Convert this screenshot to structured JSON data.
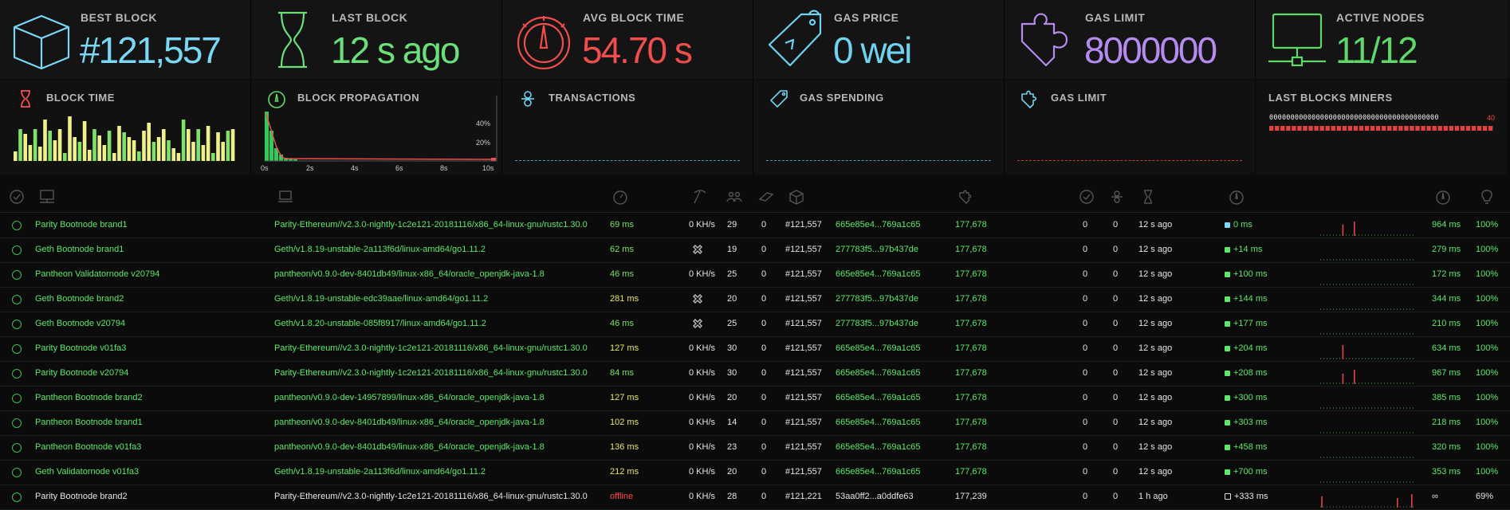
{
  "stats": [
    {
      "label": "BEST BLOCK",
      "value": "#121,557",
      "color": "#7ad8f5",
      "icon": "cube-icon"
    },
    {
      "label": "LAST BLOCK",
      "value": "12 s ago",
      "color": "#6be07a",
      "icon": "hourglass-icon"
    },
    {
      "label": "AVG BLOCK TIME",
      "value": "54.70 s",
      "color": "#f04e4e",
      "icon": "gauge-icon"
    },
    {
      "label": "GAS PRICE",
      "value": "0 wei",
      "color": "#6fd3f0",
      "icon": "price-tag-icon"
    },
    {
      "label": "GAS LIMIT",
      "value": "8000000 gas",
      "color": "#b58bf0",
      "icon": "puzzle-icon"
    },
    {
      "label": "ACTIVE NODES",
      "value": "11/12",
      "color": "#5fd86a",
      "icon": "network-icon"
    }
  ],
  "charts": {
    "block_time": {
      "label": "BLOCK TIME"
    },
    "block_propagation": {
      "label": "BLOCK PROPAGATION",
      "x_ticks": [
        "0s",
        "2s",
        "4s",
        "6s",
        "8s",
        "10s"
      ],
      "y_ticks": [
        "40%",
        "20%"
      ]
    },
    "transactions": {
      "label": "TRANSACTIONS"
    },
    "gas_spending": {
      "label": "GAS SPENDING"
    },
    "gas_limit": {
      "label": "GAS LIMIT"
    },
    "last_blocks_miners": {
      "label": "LAST BLOCKS MINERS",
      "miner": "0000000000000000000000000000000000000000",
      "count": "40"
    }
  },
  "table_header_icons": [
    "check-icon",
    "node-icon",
    "client-icon",
    "latency-icon",
    "mining-icon",
    "peers-icon",
    "pending-icon",
    "block-icon",
    "gas-limit-icon",
    "uncles-icon",
    "transactions-icon",
    "block-time-icon",
    "propagation-icon",
    "avg-propagation-icon",
    "uptime-icon"
  ],
  "nodes": [
    {
      "name": "Parity Bootnode brand1",
      "client": "Parity-Ethereum//v2.3.0-nightly-1c2e121-20181116/x86_64-linux-gnu/rustc1.30.0",
      "latency": "69 ms",
      "latency_class": "good",
      "hashrate": "0 KH/s",
      "peers": "29",
      "pending": "0",
      "block": "#121,557",
      "hash": "665e85e4...769a1c65",
      "gas": "177,678",
      "uncles": "0",
      "txs": "0",
      "last": "12 s ago",
      "prop": "0 ms",
      "prop_dot": "blue",
      "avg": "964 ms",
      "uptime": "100%",
      "offline": false,
      "hist": [
        {
          "x": 0.23,
          "h": 0.6
        },
        {
          "x": 0.35,
          "h": 0.75
        }
      ]
    },
    {
      "name": "Geth Bootnode brand1",
      "client": "Geth/v1.8.19-unstable-2a113f6d/linux-amd64/go1.11.2",
      "latency": "62 ms",
      "latency_class": "good",
      "hashrate": "",
      "peers": "19",
      "pending": "0",
      "block": "#121,557",
      "hash": "277783f5...97b437de",
      "gas": "177,678",
      "uncles": "0",
      "txs": "0",
      "last": "12 s ago",
      "prop": "+14 ms",
      "prop_dot": "green",
      "avg": "279 ms",
      "uptime": "100%",
      "offline": false,
      "hist": []
    },
    {
      "name": "Pantheon Validatornode v20794",
      "client": "pantheon/v0.9.0-dev-8401db49/linux-x86_64/oracle_openjdk-java-1.8",
      "latency": "46 ms",
      "latency_class": "good",
      "hashrate": "0 KH/s",
      "peers": "25",
      "pending": "0",
      "block": "#121,557",
      "hash": "665e85e4...769a1c65",
      "gas": "177,678",
      "uncles": "0",
      "txs": "0",
      "last": "12 s ago",
      "prop": "+100 ms",
      "prop_dot": "green",
      "avg": "172 ms",
      "uptime": "100%",
      "offline": false,
      "hist": []
    },
    {
      "name": "Geth Bootnode brand2",
      "client": "Geth/v1.8.19-unstable-edc39aae/linux-amd64/go1.11.2",
      "latency": "281 ms",
      "latency_class": "",
      "hashrate": "",
      "peers": "20",
      "pending": "0",
      "block": "#121,557",
      "hash": "277783f5...97b437de",
      "gas": "177,678",
      "uncles": "0",
      "txs": "0",
      "last": "12 s ago",
      "prop": "+144 ms",
      "prop_dot": "green",
      "avg": "344 ms",
      "uptime": "100%",
      "offline": false,
      "hist": []
    },
    {
      "name": "Geth Bootnode v20794",
      "client": "Geth/v1.8.20-unstable-085f8917/linux-amd64/go1.11.2",
      "latency": "46 ms",
      "latency_class": "good",
      "hashrate": "",
      "peers": "25",
      "pending": "0",
      "block": "#121,557",
      "hash": "277783f5...97b437de",
      "gas": "177,678",
      "uncles": "0",
      "txs": "0",
      "last": "12 s ago",
      "prop": "+177 ms",
      "prop_dot": "green",
      "avg": "210 ms",
      "uptime": "100%",
      "offline": false,
      "hist": []
    },
    {
      "name": "Parity Bootnode v01fa3",
      "client": "Parity-Ethereum//v2.3.0-nightly-1c2e121-20181116/x86_64-linux-gnu/rustc1.30.0",
      "latency": "127 ms",
      "latency_class": "",
      "hashrate": "0 KH/s",
      "peers": "30",
      "pending": "0",
      "block": "#121,557",
      "hash": "665e85e4...769a1c65",
      "gas": "177,678",
      "uncles": "0",
      "txs": "0",
      "last": "12 s ago",
      "prop": "+204 ms",
      "prop_dot": "green",
      "avg": "634 ms",
      "uptime": "100%",
      "offline": false,
      "hist": [
        {
          "x": 0.23,
          "h": 0.75
        }
      ]
    },
    {
      "name": "Parity Bootnode v20794",
      "client": "Parity-Ethereum//v2.3.0-nightly-1c2e121-20181116/x86_64-linux-gnu/rustc1.30.0",
      "latency": "84 ms",
      "latency_class": "good",
      "hashrate": "0 KH/s",
      "peers": "30",
      "pending": "0",
      "block": "#121,557",
      "hash": "665e85e4...769a1c65",
      "gas": "177,678",
      "uncles": "0",
      "txs": "0",
      "last": "12 s ago",
      "prop": "+208 ms",
      "prop_dot": "green",
      "avg": "967 ms",
      "uptime": "100%",
      "offline": false,
      "hist": [
        {
          "x": 0.23,
          "h": 0.55
        },
        {
          "x": 0.35,
          "h": 0.75
        }
      ]
    },
    {
      "name": "Pantheon Bootnode brand2",
      "client": "pantheon/v0.9.0-dev-14957899/linux-x86_64/oracle_openjdk-java-1.8",
      "latency": "127 ms",
      "latency_class": "",
      "hashrate": "0 KH/s",
      "peers": "20",
      "pending": "0",
      "block": "#121,557",
      "hash": "665e85e4...769a1c65",
      "gas": "177,678",
      "uncles": "0",
      "txs": "0",
      "last": "12 s ago",
      "prop": "+300 ms",
      "prop_dot": "green",
      "avg": "385 ms",
      "uptime": "100%",
      "offline": false,
      "hist": []
    },
    {
      "name": "Pantheon Bootnode brand1",
      "client": "pantheon/v0.9.0-dev-8401db49/linux-x86_64/oracle_openjdk-java-1.8",
      "latency": "102 ms",
      "latency_class": "",
      "hashrate": "0 KH/s",
      "peers": "14",
      "pending": "0",
      "block": "#121,557",
      "hash": "665e85e4...769a1c65",
      "gas": "177,678",
      "uncles": "0",
      "txs": "0",
      "last": "12 s ago",
      "prop": "+303 ms",
      "prop_dot": "green",
      "avg": "218 ms",
      "uptime": "100%",
      "offline": false,
      "hist": []
    },
    {
      "name": "Pantheon Bootnode v01fa3",
      "client": "pantheon/v0.9.0-dev-8401db49/linux-x86_64/oracle_openjdk-java-1.8",
      "latency": "136 ms",
      "latency_class": "",
      "hashrate": "0 KH/s",
      "peers": "23",
      "pending": "0",
      "block": "#121,557",
      "hash": "665e85e4...769a1c65",
      "gas": "177,678",
      "uncles": "0",
      "txs": "0",
      "last": "12 s ago",
      "prop": "+458 ms",
      "prop_dot": "green",
      "avg": "320 ms",
      "uptime": "100%",
      "offline": false,
      "hist": []
    },
    {
      "name": "Geth Validatornode v01fa3",
      "client": "Geth/v1.8.19-unstable-2a113f6d/linux-amd64/go1.11.2",
      "latency": "212 ms",
      "latency_class": "",
      "hashrate": "0 KH/s",
      "peers": "20",
      "pending": "0",
      "block": "#121,557",
      "hash": "665e85e4...769a1c65",
      "gas": "177,678",
      "uncles": "0",
      "txs": "0",
      "last": "12 s ago",
      "prop": "+700 ms",
      "prop_dot": "green",
      "avg": "353 ms",
      "uptime": "100%",
      "offline": false,
      "hist": []
    },
    {
      "name": "Parity Bootnode brand2",
      "client": "Parity-Ethereum//v2.3.0-nightly-1c2e121-20181116/x86_64-linux-gnu/rustc1.30.0",
      "latency": "offline",
      "latency_class": "off",
      "hashrate": "0 KH/s",
      "peers": "28",
      "pending": "0",
      "block": "#121,221",
      "hash": "53aa0ff2...a0ddfe63",
      "gas": "177,239",
      "uncles": "0",
      "txs": "0",
      "last": "1 h ago",
      "prop": "+333 ms",
      "prop_dot": "open",
      "avg": "∞",
      "uptime": "69%",
      "offline": true,
      "hist": [
        {
          "x": 0.01,
          "h": 0.6
        },
        {
          "x": 0.8,
          "h": 0.5
        },
        {
          "x": 0.95,
          "h": 0.7
        }
      ]
    }
  ]
}
